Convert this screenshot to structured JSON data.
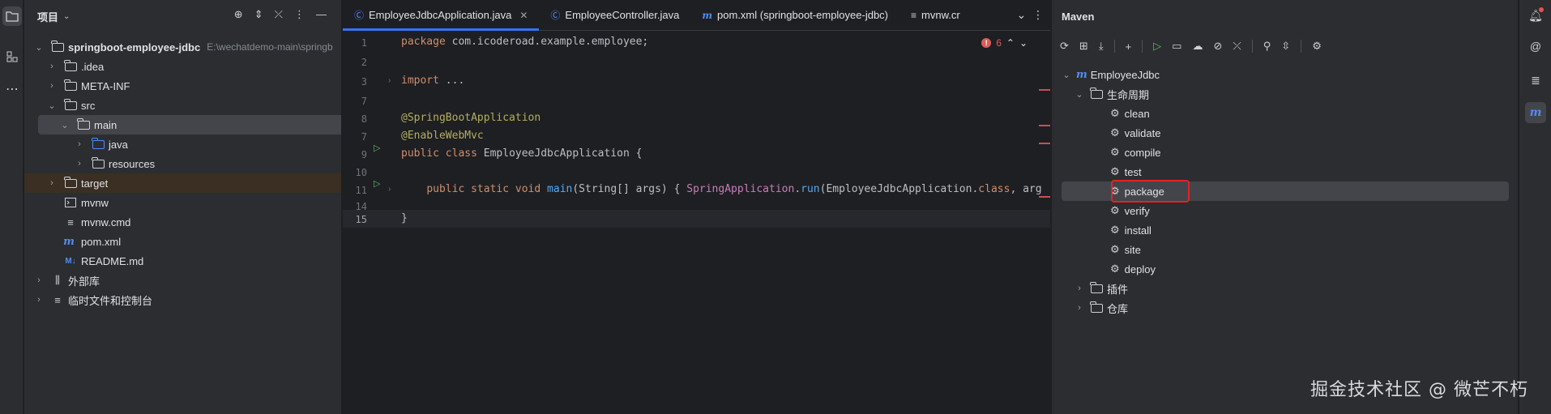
{
  "left_strip": {
    "icons": [
      "folder-icon",
      "structure-icon",
      "more-icon"
    ]
  },
  "project": {
    "title": "项目",
    "tree": [
      {
        "label": "springboot-employee-jdbc",
        "extra": "E:\\wechatdemo-main\\springb",
        "depth": 0,
        "expanded": true,
        "icon": "module"
      },
      {
        "label": ".idea",
        "depth": 1,
        "expanded": false,
        "icon": "folder"
      },
      {
        "label": "META-INF",
        "depth": 1,
        "expanded": false,
        "icon": "folder"
      },
      {
        "label": "src",
        "depth": 1,
        "expanded": true,
        "icon": "folder"
      },
      {
        "label": "main",
        "depth": 2,
        "expanded": true,
        "icon": "folder",
        "selected": true
      },
      {
        "label": "java",
        "depth": 3,
        "expanded": false,
        "icon": "folder-blue"
      },
      {
        "label": "resources",
        "depth": 3,
        "expanded": false,
        "icon": "folder"
      },
      {
        "label": "target",
        "depth": 1,
        "expanded": false,
        "icon": "folder",
        "highlight": true
      },
      {
        "label": "mvnw",
        "depth": 1,
        "icon": "file"
      },
      {
        "label": "mvnw.cmd",
        "depth": 1,
        "icon": "text"
      },
      {
        "label": "pom.xml",
        "depth": 1,
        "icon": "maven"
      },
      {
        "label": "README.md",
        "depth": 1,
        "icon": "md"
      },
      {
        "label": "外部库",
        "depth": 0,
        "expanded": false,
        "icon": "library"
      },
      {
        "label": "临时文件和控制台",
        "depth": 0,
        "expanded": false,
        "icon": "scratch"
      }
    ]
  },
  "editor": {
    "tabs": [
      {
        "label": "EmployeeJdbcApplication.java",
        "icon": "class",
        "active": true
      },
      {
        "label": "EmployeeController.java",
        "icon": "class"
      },
      {
        "label": "pom.xml (springboot-employee-jdbc)",
        "icon": "maven"
      },
      {
        "label": "mvnw.cr",
        "icon": "text"
      }
    ],
    "error_count": "6",
    "lines": [
      {
        "num": "1",
        "text": "package com.icoderoad.example.employee;"
      },
      {
        "num": "2",
        "text": ""
      },
      {
        "num": "3",
        "text": "import ..."
      },
      {
        "num": "7",
        "text": ""
      },
      {
        "num": "8",
        "text": "@SpringBootApplication"
      },
      {
        "num": "7",
        "text": "@EnableWebMvc"
      },
      {
        "num": "9",
        "text": "public class EmployeeJdbcApplication {"
      },
      {
        "num": "10",
        "text": ""
      },
      {
        "num": "11",
        "text": "    public static void main(String[] args) { SpringApplication.run(EmployeeJdbcApplication.class, arg"
      },
      {
        "num": "14",
        "text": ""
      },
      {
        "num": "15",
        "text": "}"
      }
    ]
  },
  "maven": {
    "title": "Maven",
    "project": "EmployeeJdbc",
    "lifecycle_label": "生命周期",
    "phases": [
      "clean",
      "validate",
      "compile",
      "test",
      "package",
      "verify",
      "install",
      "site",
      "deploy"
    ],
    "selected_phase": "package",
    "plugins_label": "插件",
    "repos_label": "仓库"
  },
  "watermark": "掘金技术社区 @ 微芒不朽"
}
